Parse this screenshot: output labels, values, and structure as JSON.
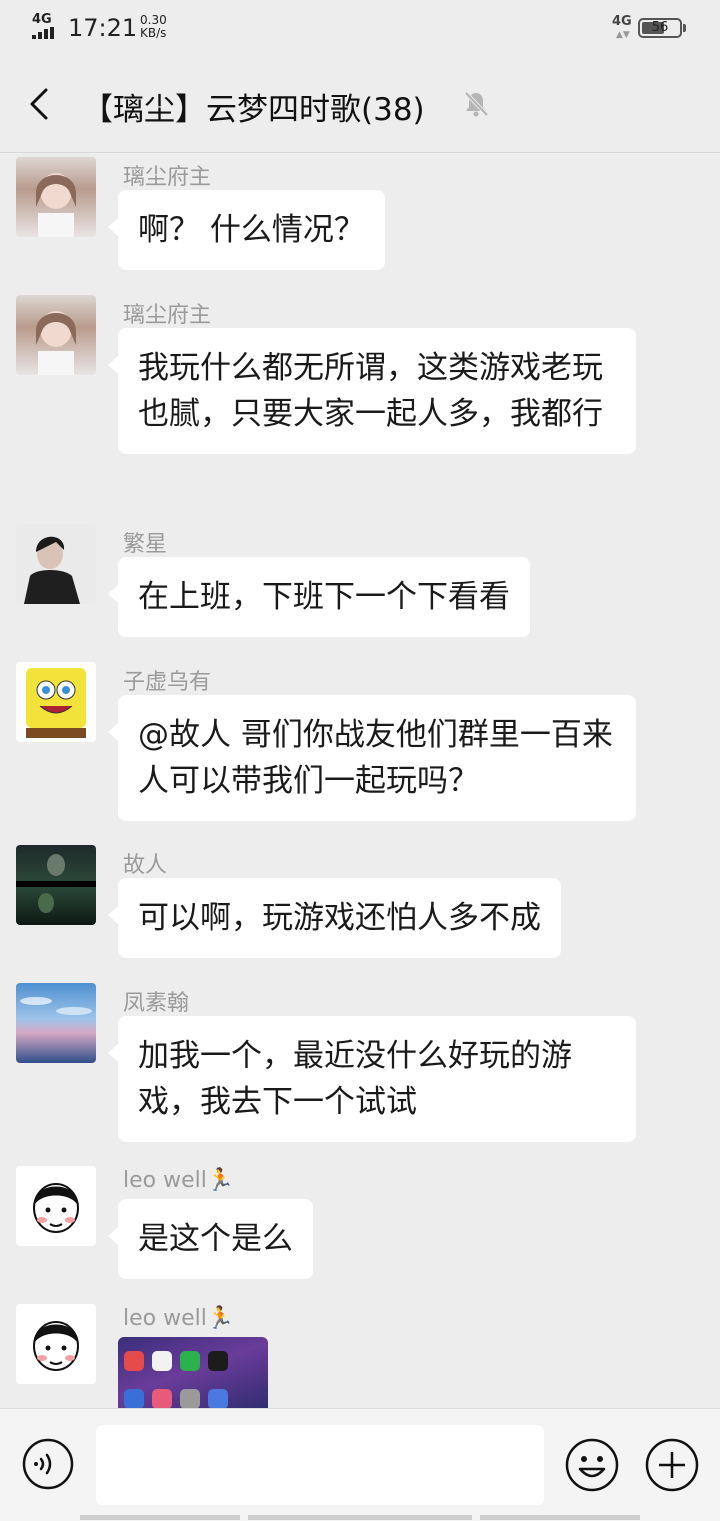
{
  "status_bar": {
    "network": "4G",
    "time": "17:21",
    "speed_value": "0.30",
    "speed_unit": "KB/s",
    "network_right": "4G",
    "battery": "56"
  },
  "header": {
    "title": "【璃尘】云梦四时歌(38)",
    "back_icon": "chevron-left-icon",
    "mute_icon": "bell-off-icon"
  },
  "messages": [
    {
      "sender": "璃尘府主",
      "text": "啊？ 什么情况？",
      "avatar": "girl-photo"
    },
    {
      "sender": "璃尘府主",
      "text": "我玩什么都无所谓，这类游戏老玩也腻，只要大家一起人多，我都行",
      "avatar": "girl-photo"
    },
    {
      "sender": "繁星",
      "text": "在上班，下班下一个下看看",
      "avatar": "man-photo"
    },
    {
      "sender": "子虚乌有",
      "text": "@故人 哥们你战友他们群里一百来人可以带我们一起玩吗？",
      "avatar": "spongebob"
    },
    {
      "sender": "故人",
      "text": "可以啊，玩游戏还怕人多不成",
      "avatar": "dark-movie-scene"
    },
    {
      "sender": "凤素翰",
      "text": "加我一个，最近没什么好玩的游戏，我去下一个试试",
      "avatar": "sky-scenery"
    },
    {
      "sender": "leo well🏃",
      "text": "是这个是么",
      "avatar": "cartoon-boy"
    },
    {
      "sender": "leo well🏃",
      "image": "phone-home-screen",
      "avatar": "cartoon-boy"
    }
  ],
  "input_bar": {
    "placeholder": "",
    "voice_icon": "voice-icon",
    "emoji_icon": "emoji-icon",
    "plus_icon": "plus-icon"
  },
  "colors": {
    "background": "#ededed",
    "bubble": "#ffffff",
    "sender_name": "#9a9a9a"
  }
}
